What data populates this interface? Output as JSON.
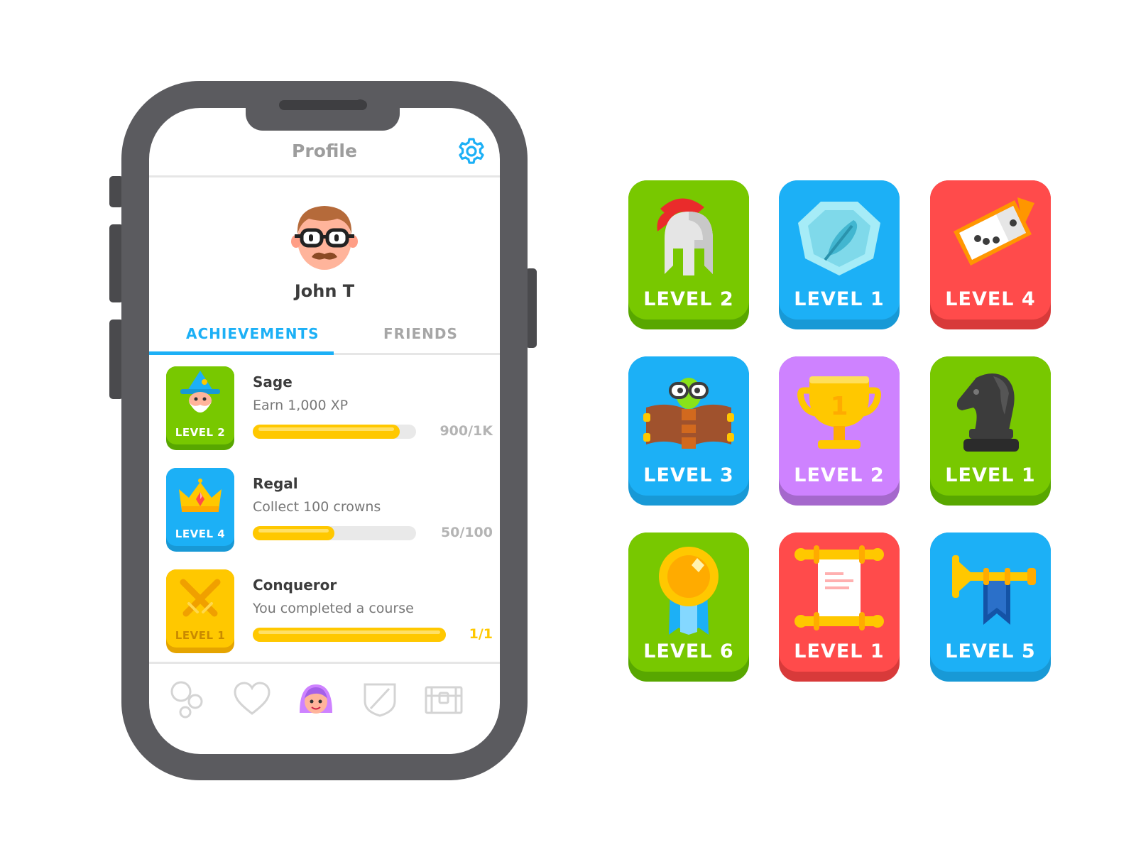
{
  "profile": {
    "title": "Profile",
    "username": "John T",
    "tabs": {
      "achievements": "ACHIEVEMENTS",
      "friends": "FRIENDS"
    }
  },
  "achievements": [
    {
      "badge_level": "LEVEL 2",
      "title": "Sage",
      "description": "Earn 1,000 XP",
      "progress": 0.9,
      "progress_text": "900/1K",
      "badge_color": "#78c800"
    },
    {
      "badge_level": "LEVEL 4",
      "title": "Regal",
      "description": "Collect 100 crowns",
      "progress": 0.5,
      "progress_text": "50/100",
      "badge_color": "#1cb0f6"
    },
    {
      "badge_level": "LEVEL 1",
      "title": "Conqueror",
      "description": "You completed a course",
      "progress": 1.0,
      "progress_text": "1/1",
      "badge_color": "#ffc800"
    }
  ],
  "bottom_nav": [
    "learn-icon",
    "heart-icon",
    "profile-icon",
    "shield-icon",
    "chest-icon"
  ],
  "badges": [
    {
      "level": "LEVEL 2",
      "color": "#78c800",
      "shade": "#58a700",
      "icon": "helmet-icon"
    },
    {
      "level": "LEVEL 1",
      "color": "#1cb0f6",
      "shade": "#1899d6",
      "icon": "feather-gem-icon"
    },
    {
      "level": "LEVEL 4",
      "color": "#ff4b4b",
      "shade": "#d83a3a",
      "icon": "domino-icon"
    },
    {
      "level": "LEVEL 3",
      "color": "#1cb0f6",
      "shade": "#1899d6",
      "icon": "bookworm-icon"
    },
    {
      "level": "LEVEL 2",
      "color": "#ce82ff",
      "shade": "#a568cc",
      "icon": "trophy-icon"
    },
    {
      "level": "LEVEL 1",
      "color": "#78c800",
      "shade": "#58a700",
      "icon": "chess-knight-icon"
    },
    {
      "level": "LEVEL 6",
      "color": "#78c800",
      "shade": "#58a700",
      "icon": "medal-icon"
    },
    {
      "level": "LEVEL 1",
      "color": "#ff4b4b",
      "shade": "#d83a3a",
      "icon": "scroll-icon"
    },
    {
      "level": "LEVEL 5",
      "color": "#1cb0f6",
      "shade": "#1899d6",
      "icon": "trumpet-icon"
    }
  ],
  "colors": {
    "accent": "#1cb0f6",
    "progress": "#ffc800",
    "phone": "#5b5b5f"
  }
}
